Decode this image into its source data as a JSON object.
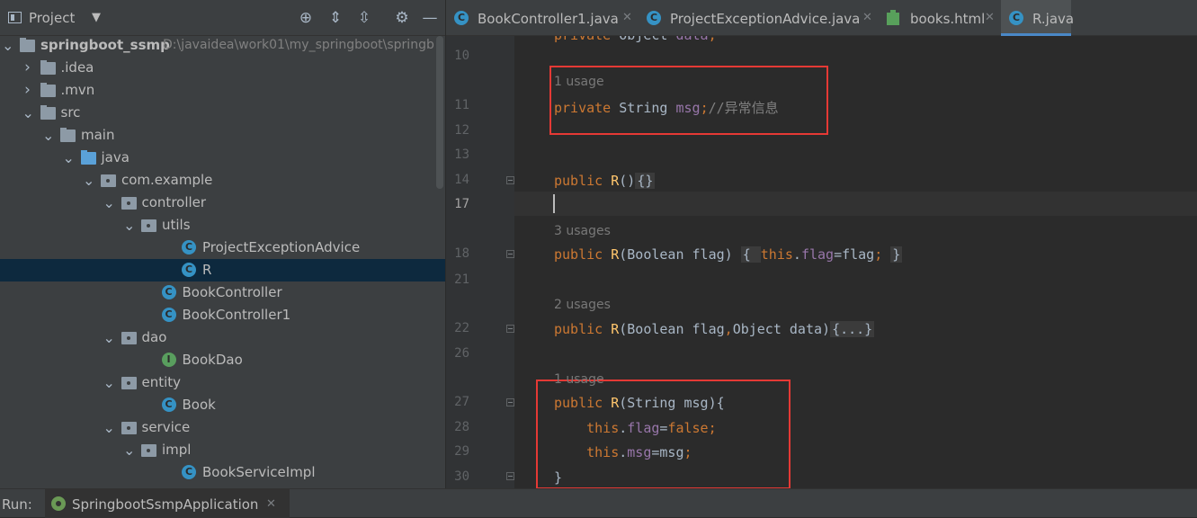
{
  "project_panel": {
    "title": "Project",
    "tree": [
      {
        "label": "springboot_ssmp",
        "path": "D:\\javaidea\\work01\\my_springboot\\springb",
        "kind": "module",
        "arrow": "open",
        "depth": 0
      },
      {
        "label": ".idea",
        "kind": "folder",
        "arrow": "closed",
        "depth": 1
      },
      {
        "label": ".mvn",
        "kind": "folder",
        "arrow": "closed",
        "depth": 1
      },
      {
        "label": "src",
        "kind": "folder",
        "arrow": "open",
        "depth": 1
      },
      {
        "label": "main",
        "kind": "folder",
        "arrow": "open",
        "depth": 2
      },
      {
        "label": "java",
        "kind": "source-folder",
        "arrow": "open",
        "depth": 3
      },
      {
        "label": "com.example",
        "kind": "package",
        "arrow": "open",
        "depth": 4
      },
      {
        "label": "controller",
        "kind": "package",
        "arrow": "open",
        "depth": 5
      },
      {
        "label": "utils",
        "kind": "package",
        "arrow": "open",
        "depth": 6
      },
      {
        "label": "ProjectExceptionAdvice",
        "kind": "class",
        "depth": 8
      },
      {
        "label": "R",
        "kind": "class",
        "depth": 8,
        "selected": true
      },
      {
        "label": "BookController",
        "kind": "class",
        "depth": 7
      },
      {
        "label": "BookController1",
        "kind": "class",
        "depth": 7
      },
      {
        "label": "dao",
        "kind": "package",
        "arrow": "open",
        "depth": 5
      },
      {
        "label": "BookDao",
        "kind": "interface",
        "depth": 7
      },
      {
        "label": "entity",
        "kind": "package",
        "arrow": "open",
        "depth": 5
      },
      {
        "label": "Book",
        "kind": "class",
        "depth": 7
      },
      {
        "label": "service",
        "kind": "package",
        "arrow": "open",
        "depth": 5
      },
      {
        "label": "impl",
        "kind": "package",
        "arrow": "open",
        "depth": 6
      },
      {
        "label": "BookServiceImpl",
        "kind": "class",
        "depth": 8
      }
    ]
  },
  "tabs": [
    {
      "label": "BookController1.java",
      "icon": "class-icon",
      "active": false
    },
    {
      "label": "ProjectExceptionAdvice.java",
      "icon": "class-icon",
      "active": false
    },
    {
      "label": "books.html",
      "icon": "html-file-icon",
      "active": false
    },
    {
      "label": "R.java",
      "icon": "class-icon",
      "active": true
    }
  ],
  "editor": {
    "lines": [
      {
        "n": "",
        "code": [
          [
            "kw",
            "private "
          ],
          [
            "type",
            "Object "
          ],
          [
            "field",
            "data"
          ],
          [
            "kw",
            ";"
          ]
        ]
      },
      {
        "n": "10",
        "code": []
      },
      {
        "n": "",
        "hint": "1 usage"
      },
      {
        "n": "11",
        "code": [
          [
            "kw",
            "private "
          ],
          [
            "type",
            "String "
          ],
          [
            "field",
            "msg"
          ],
          [
            "kw",
            ";"
          ],
          [
            "cmt",
            "//异常信息"
          ]
        ]
      },
      {
        "n": "12",
        "code": []
      },
      {
        "n": "13",
        "code": []
      },
      {
        "n": "14",
        "code": [
          [
            "kw",
            "public "
          ],
          [
            "fn",
            "R"
          ],
          [
            "type",
            "()"
          ],
          [
            "fold",
            "{}"
          ]
        ]
      },
      {
        "n": "17",
        "code": [],
        "current": true
      },
      {
        "n": "",
        "hint": "3 usages"
      },
      {
        "n": "18",
        "code": [
          [
            "kw",
            "public "
          ],
          [
            "fn",
            "R"
          ],
          [
            "type",
            "(Boolean flag) "
          ],
          [
            "fold",
            "{ "
          ],
          [
            "kw",
            "this"
          ],
          [
            "type",
            "."
          ],
          [
            "field",
            "flag"
          ],
          [
            "type",
            "=flag"
          ],
          [
            "kw",
            "; "
          ],
          [
            "fold",
            "}"
          ]
        ]
      },
      {
        "n": "21",
        "code": []
      },
      {
        "n": "",
        "hint": "2 usages"
      },
      {
        "n": "22",
        "code": [
          [
            "kw",
            "public "
          ],
          [
            "fn",
            "R"
          ],
          [
            "type",
            "(Boolean flag"
          ],
          [
            "kw",
            ","
          ],
          [
            "type",
            "Object data)"
          ],
          [
            "fold",
            "{...}"
          ]
        ]
      },
      {
        "n": "26",
        "code": []
      },
      {
        "n": "",
        "hint": "1 usage"
      },
      {
        "n": "27",
        "code": [
          [
            "kw",
            "public "
          ],
          [
            "fn",
            "R"
          ],
          [
            "type",
            "(String msg){"
          ]
        ]
      },
      {
        "n": "28",
        "code": [
          [
            "type",
            "    "
          ],
          [
            "kw",
            "this"
          ],
          [
            "type",
            "."
          ],
          [
            "field",
            "flag"
          ],
          [
            "type",
            "="
          ],
          [
            "kw",
            "false;"
          ]
        ]
      },
      {
        "n": "29",
        "code": [
          [
            "type",
            "    "
          ],
          [
            "kw",
            "this"
          ],
          [
            "type",
            "."
          ],
          [
            "field",
            "msg"
          ],
          [
            "type",
            "=msg"
          ],
          [
            "kw",
            ";"
          ]
        ]
      },
      {
        "n": "30",
        "code": [
          [
            "type",
            "}"
          ]
        ]
      }
    ]
  },
  "run_bar": {
    "label": "Run:",
    "config": "SpringbootSsmpApplication"
  },
  "colors": {
    "keyword": "#cc7832",
    "field": "#9876aa",
    "method": "#ffc66d",
    "comment": "#808080",
    "highlight_box": "#e53935",
    "active_tab_underline": "#4a88c7"
  }
}
